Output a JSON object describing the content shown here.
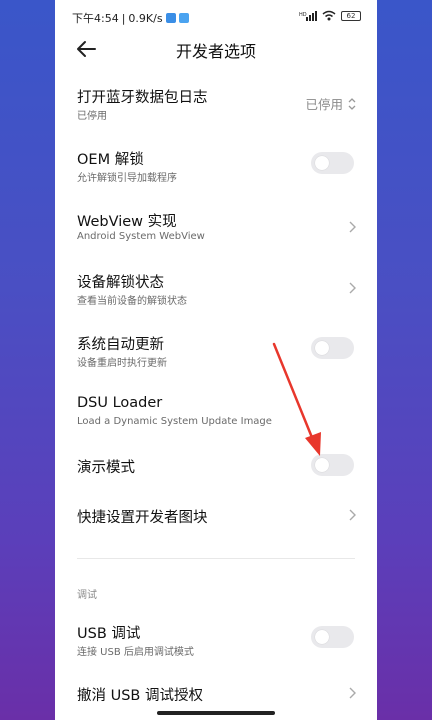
{
  "status_bar": {
    "time": "下午4:54",
    "separator": "|",
    "speed": "0.9K/s",
    "signal": "HD",
    "battery": "62"
  },
  "header": {
    "title": "开发者选项"
  },
  "settings": {
    "bt_log": {
      "title": "打开蓝牙数据包日志",
      "subtitle": "已停用",
      "value": "已停用"
    },
    "oem_unlock": {
      "title": "OEM 解锁",
      "subtitle": "允许解锁引导加载程序",
      "enabled": false
    },
    "webview": {
      "title": "WebView 实现",
      "subtitle": "Android System WebView"
    },
    "unlock_state": {
      "title": "设备解锁状态",
      "subtitle": "查看当前设备的解锁状态"
    },
    "auto_update": {
      "title": "系统自动更新",
      "subtitle": "设备重启时执行更新",
      "enabled": false
    },
    "dsu_loader": {
      "title": "DSU Loader",
      "subtitle": "Load a Dynamic System Update Image"
    },
    "demo_mode": {
      "title": "演示模式",
      "enabled": false
    },
    "quick_tiles": {
      "title": "快捷设置开发者图块"
    }
  },
  "debug_section": {
    "label": "调试",
    "usb_debug": {
      "title": "USB 调试",
      "subtitle": "连接 USB 后启用调试模式",
      "enabled": false
    },
    "revoke_usb": {
      "title": "撤消 USB 调试授权"
    }
  },
  "colors": {
    "annotation_arrow": "#e8372c",
    "toggle_off": "#e9e9ec"
  },
  "icons": [
    "back-arrow-icon",
    "chevron-right-icon",
    "updown-chevron-icon",
    "wifi-icon",
    "signal-icon",
    "battery-icon"
  ]
}
